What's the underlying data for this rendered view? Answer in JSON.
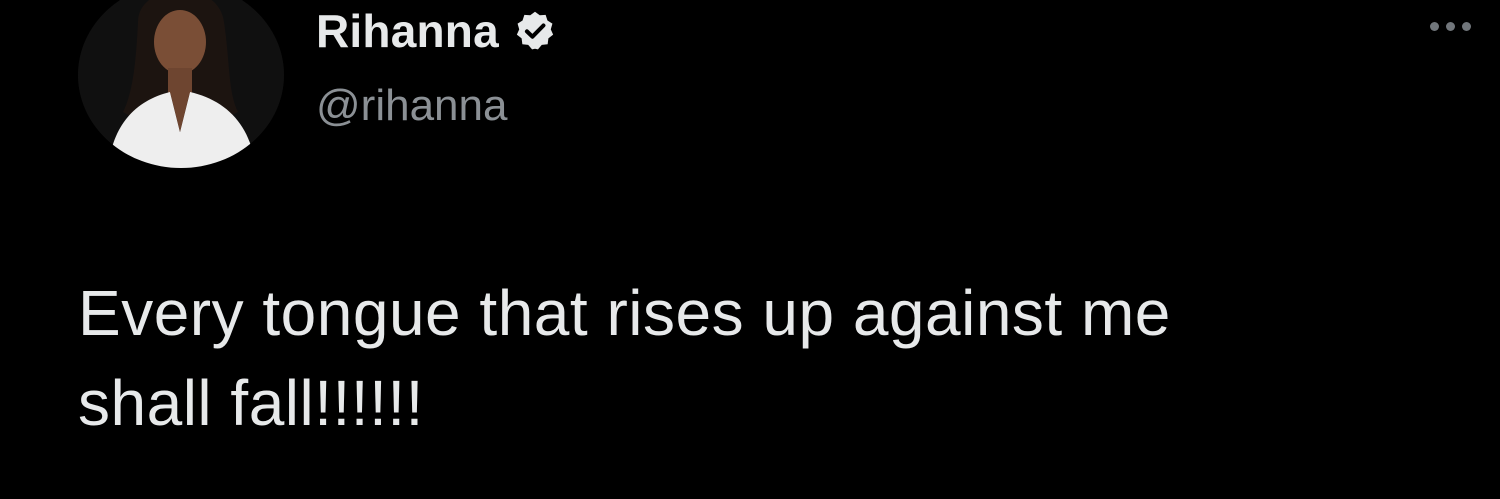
{
  "tweet": {
    "author": {
      "display_name": "Rihanna",
      "handle": "@rihanna",
      "verified": true,
      "avatar_icon": "profile-photo"
    },
    "text_line_1": "Every tongue that rises up against me",
    "text_line_2": "shall fall!!!!!!",
    "more_icon": "ellipsis-icon"
  },
  "colors": {
    "background": "#000000",
    "primary_text": "#e7e9ea",
    "secondary_text": "#8b9095",
    "icon": "#71767b"
  }
}
